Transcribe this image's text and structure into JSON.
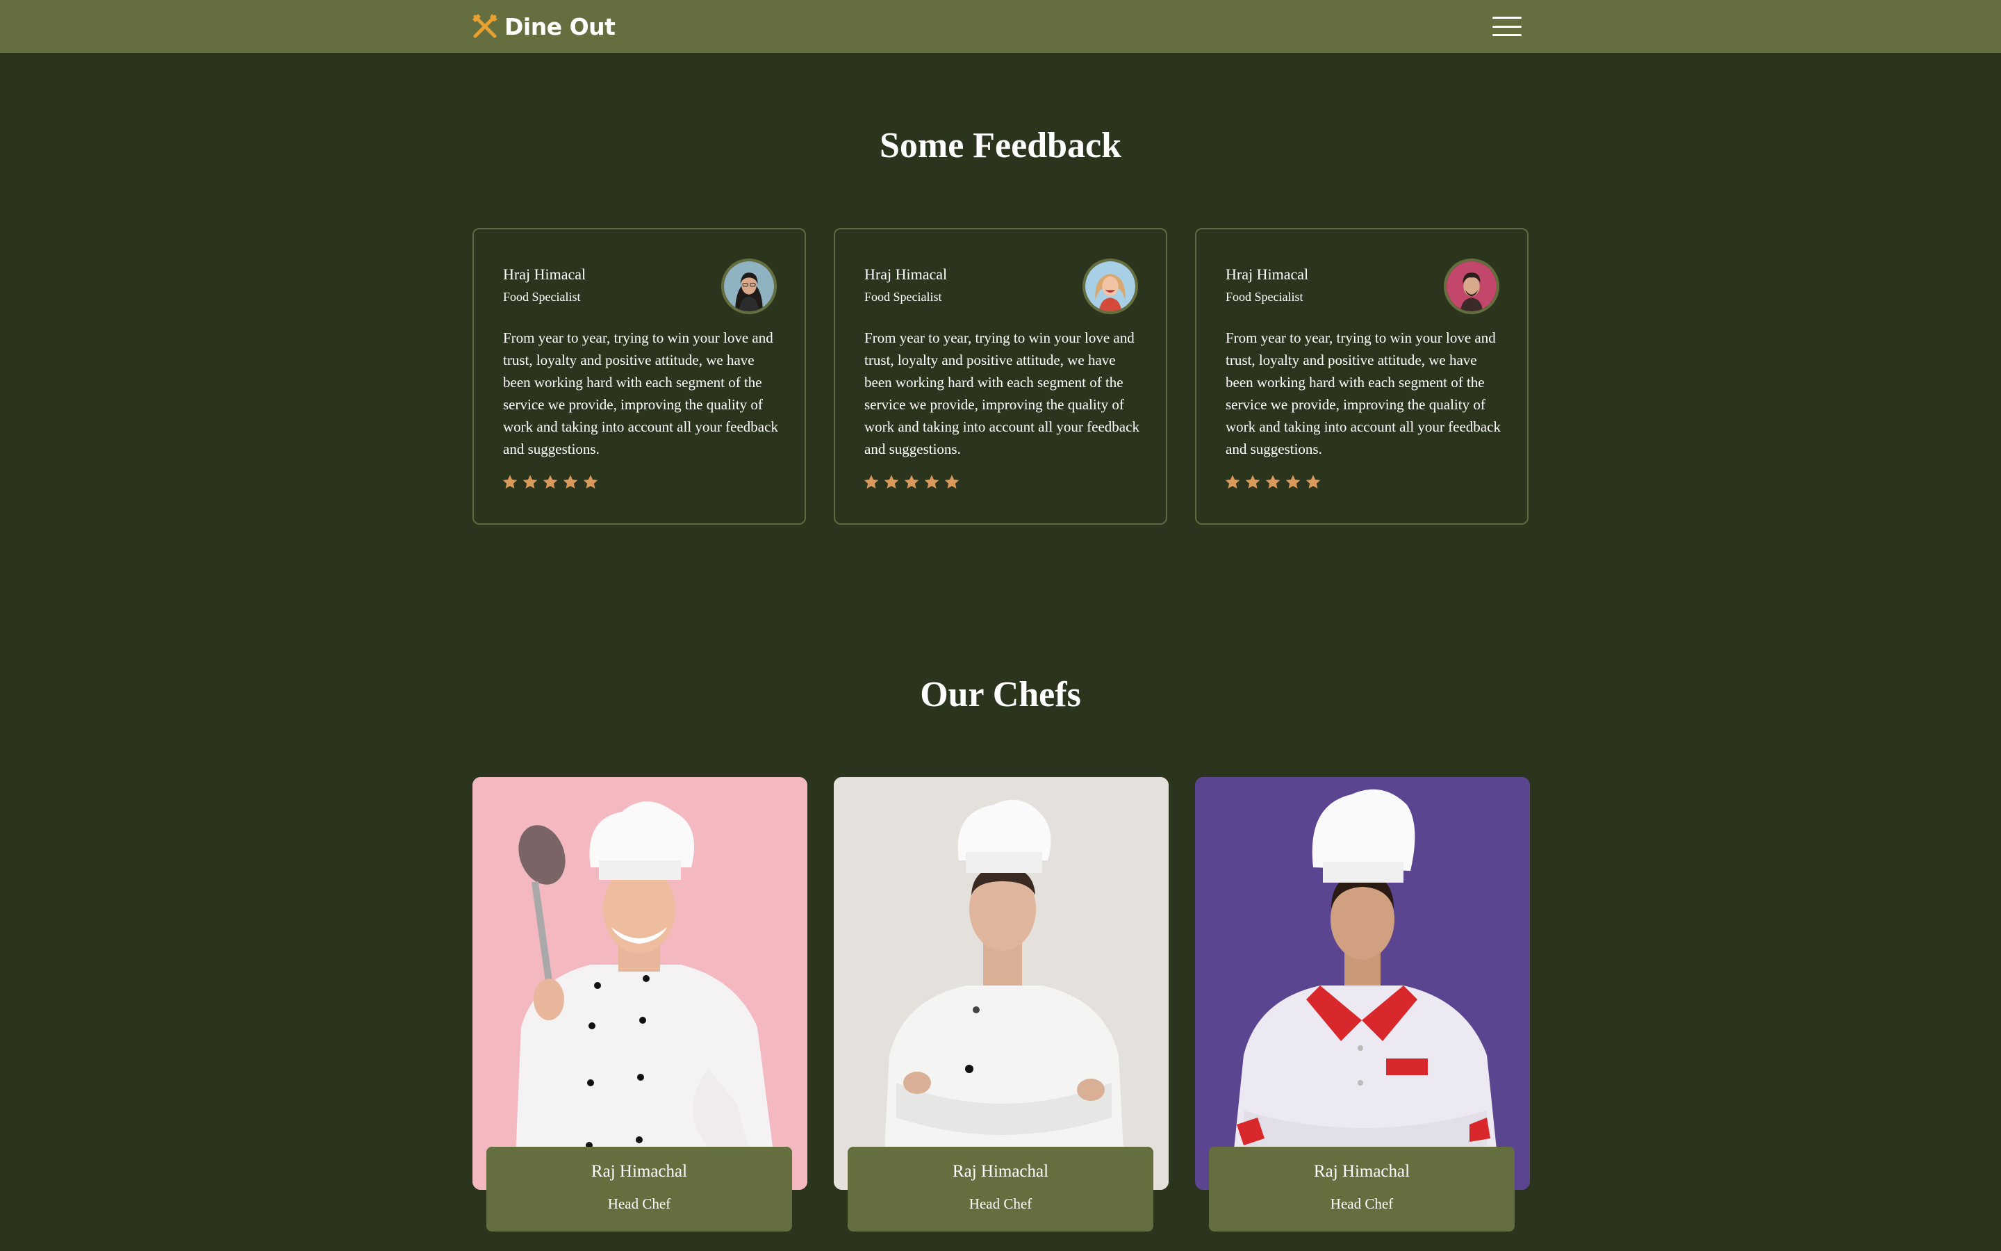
{
  "navbar": {
    "brand": "Dine Out",
    "brand_icon": "fork-knife-icon",
    "menu_icon": "hamburger-menu-icon",
    "brand_color": "#e8a030",
    "background": "#646e3f"
  },
  "feedback": {
    "title": "Some Feedback",
    "cards": [
      {
        "name": "Hraj Himacal",
        "role": "Food Specialist",
        "text": "From year to year, trying to win your love and trust, loyalty and positive attitude, we have been working hard with each segment of the service we provide, improving the quality of work and taking into account all your feedback and suggestions.",
        "rating": 5
      },
      {
        "name": "Hraj Himacal",
        "role": "Food Specialist",
        "text": "From year to year, trying to win your love and trust, loyalty and positive attitude, we have been working hard with each segment of the service we provide, improving the quality of work and taking into account all your feedback and suggestions.",
        "rating": 5
      },
      {
        "name": "Hraj Himacal",
        "role": "Food Specialist",
        "text": "From year to year, trying to win your love and trust, loyalty and positive attitude, we have been working hard with each segment of the service we provide, improving the quality of work and taking into account all your feedback and suggestions.",
        "rating": 5
      }
    ],
    "star_color": "#d99a5c"
  },
  "chefs": {
    "title": "Our Chefs",
    "cards": [
      {
        "name": "Raj Himachal",
        "role": "Head Chef",
        "background": "#f3b8c0"
      },
      {
        "name": "Raj Himachal",
        "role": "Head Chef",
        "background": "#e4e0dc"
      },
      {
        "name": "Raj Himachal",
        "role": "Head Chef",
        "background": "#5b4490"
      }
    ]
  }
}
